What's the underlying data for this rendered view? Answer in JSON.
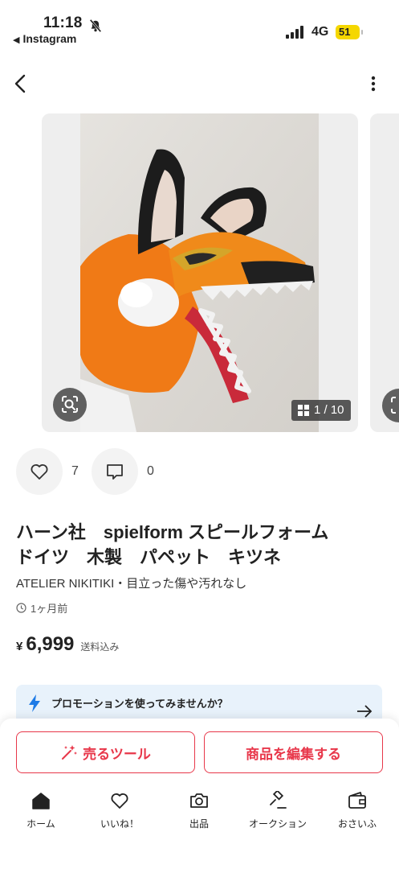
{
  "status_bar": {
    "time": "11:18",
    "back_app": "Instagram",
    "network": "4G",
    "battery": "51"
  },
  "listing": {
    "image_counter": "1 / 10",
    "likes_count": "7",
    "comments_count": "0",
    "title_line1": "ハーン社　spielform スピールフォーム",
    "title_line2": "ドイツ　木製　パペット　キツネ",
    "subtitle": "ATELIER NIKITIKI・目立った傷や汚れなし",
    "posted": "1ヶ月前",
    "price_symbol": "¥",
    "price": "6,999",
    "shipping": "送料込み"
  },
  "promo": {
    "text": "プロモーションを使ってみませんか？"
  },
  "buttons": {
    "sell_tool": "売るツール",
    "edit_item": "商品を編集する"
  },
  "tabbar": {
    "home": "ホーム",
    "likes": "いいね！",
    "listing": "出品",
    "auction": "オークション",
    "wallet": "おさいふ"
  },
  "colors": {
    "accent": "#e8374a",
    "promo_bg": "#e8f2fb",
    "bolt": "#1e7be6"
  }
}
